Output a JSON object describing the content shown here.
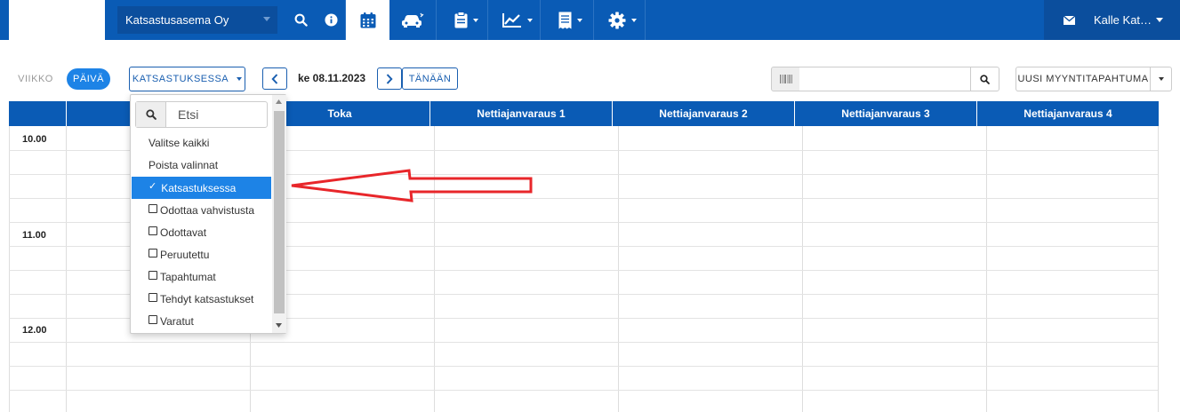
{
  "topbar": {
    "company": "Katsastusasema Oy",
    "user": "Kalle Kat…",
    "icons": [
      "search-icon",
      "info-icon",
      "calendar-icon",
      "car-icon",
      "clipboard-icon",
      "chart-icon",
      "receipt-icon",
      "gear-icon",
      "mail-icon"
    ]
  },
  "toolbar": {
    "week": "VIIKKO",
    "day": "PÄIVÄ",
    "status_filter": "KATSASTUKSESSA",
    "date": "ke 08.11.2023",
    "today": "TÄNÄÄN",
    "search_value": "",
    "new_sale": "UUSI MYYNTITAPAHTUMA"
  },
  "grid": {
    "columns": [
      "",
      "",
      "Toka",
      "Nettiajanvaraus 1",
      "Nettiajanvaraus 2",
      "Nettiajanvaraus 3",
      "Nettiajanvaraus 4"
    ],
    "hours": [
      "10.00",
      "11.00",
      "12.00"
    ]
  },
  "dropdown": {
    "search_placeholder": "Etsi",
    "select_all": "Valitse kaikki",
    "clear": "Poista valinnat",
    "options": [
      {
        "label": "Katsastuksessa",
        "checked": true
      },
      {
        "label": "Odottaa vahvistusta",
        "checked": false
      },
      {
        "label": "Odottavat",
        "checked": false
      },
      {
        "label": "Peruutettu",
        "checked": false
      },
      {
        "label": "Tapahtumat",
        "checked": false
      },
      {
        "label": "Tehdyt katsastukset",
        "checked": false
      },
      {
        "label": "Varatut",
        "checked": false
      }
    ]
  },
  "colors": {
    "brand": "#0a5bb5",
    "selected": "#1d83e6",
    "annotation_arrow": "#e8262a"
  }
}
